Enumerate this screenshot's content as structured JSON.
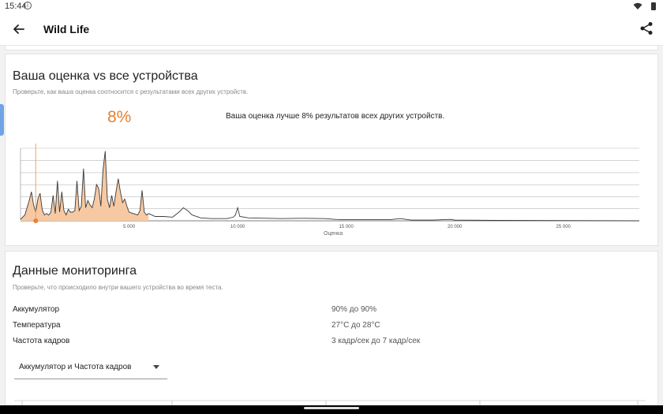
{
  "status_bar": {
    "time": "15:44",
    "info_icon": "info-icon",
    "wifi_icon": "wifi-icon",
    "battery_icon": "battery-icon"
  },
  "app_bar": {
    "title": "Wild Life",
    "back_icon": "arrow-left-icon",
    "share_icon": "share-icon"
  },
  "comparison": {
    "heading": "Ваша оценка vs все устройства",
    "subtitle": "Проверьте, как ваша оценка соотносится с результатами всех других устройств.",
    "percent": "8%",
    "statement": "Ваша оценка лучше 8% результатов всех других устройств.",
    "accent_color": "#e8802e"
  },
  "chart_data": {
    "type": "area",
    "xlabel": "Оценка",
    "ylabel": "",
    "x_ticks": [
      "5 000",
      "10 000",
      "15 000",
      "20 000",
      "25 000"
    ],
    "x_tick_values": [
      5000,
      10000,
      15000,
      20000,
      25000
    ],
    "xlim": [
      0,
      28500
    ],
    "ylim": [
      0,
      100
    ],
    "grid": true,
    "highlighted_range_max": 5900,
    "user_score_marker": 700,
    "series": [
      {
        "values": [
          [
            0,
            2
          ],
          [
            200,
            8
          ],
          [
            300,
            18
          ],
          [
            400,
            28
          ],
          [
            500,
            40
          ],
          [
            600,
            22
          ],
          [
            700,
            12
          ],
          [
            800,
            30
          ],
          [
            900,
            38
          ],
          [
            1000,
            15
          ],
          [
            1100,
            8
          ],
          [
            1200,
            10
          ],
          [
            1300,
            8
          ],
          [
            1400,
            12
          ],
          [
            1500,
            35
          ],
          [
            1600,
            10
          ],
          [
            1700,
            55
          ],
          [
            1800,
            12
          ],
          [
            1900,
            40
          ],
          [
            2000,
            14
          ],
          [
            2100,
            8
          ],
          [
            2200,
            16
          ],
          [
            2300,
            12
          ],
          [
            2400,
            12
          ],
          [
            2500,
            14
          ],
          [
            2600,
            55
          ],
          [
            2700,
            14
          ],
          [
            2800,
            20
          ],
          [
            2900,
            72
          ],
          [
            3000,
            18
          ],
          [
            3100,
            28
          ],
          [
            3200,
            22
          ],
          [
            3300,
            18
          ],
          [
            3400,
            30
          ],
          [
            3500,
            50
          ],
          [
            3600,
            45
          ],
          [
            3700,
            20
          ],
          [
            3800,
            70
          ],
          [
            3900,
            96
          ],
          [
            4000,
            30
          ],
          [
            4100,
            18
          ],
          [
            4200,
            35
          ],
          [
            4300,
            20
          ],
          [
            4400,
            40
          ],
          [
            4500,
            58
          ],
          [
            4600,
            40
          ],
          [
            4700,
            25
          ],
          [
            4800,
            30
          ],
          [
            4900,
            20
          ],
          [
            5000,
            12
          ],
          [
            5200,
            10
          ],
          [
            5400,
            8
          ],
          [
            5500,
            14
          ],
          [
            5600,
            42
          ],
          [
            5700,
            12
          ],
          [
            5800,
            8
          ],
          [
            5900,
            10
          ],
          [
            6200,
            6
          ],
          [
            6600,
            6
          ],
          [
            7000,
            5
          ],
          [
            7300,
            12
          ],
          [
            7500,
            18
          ],
          [
            7700,
            14
          ],
          [
            7900,
            8
          ],
          [
            8300,
            4
          ],
          [
            8800,
            3
          ],
          [
            9500,
            3
          ],
          [
            9800,
            5
          ],
          [
            9900,
            8
          ],
          [
            10000,
            18
          ],
          [
            10100,
            6
          ],
          [
            10500,
            4
          ],
          [
            12000,
            3
          ],
          [
            13000,
            3.5
          ],
          [
            14000,
            3
          ],
          [
            14500,
            2
          ],
          [
            15000,
            1.5
          ],
          [
            17000,
            1.5
          ],
          [
            17500,
            3
          ],
          [
            18000,
            1
          ],
          [
            19000,
            1
          ],
          [
            19800,
            2
          ],
          [
            20000,
            1
          ],
          [
            22000,
            0.5
          ],
          [
            25000,
            0.3
          ],
          [
            28500,
            0
          ]
        ]
      }
    ]
  },
  "monitoring": {
    "heading": "Данные мониторинга",
    "subtitle": "Проверьте, что происходило внутри вашего устройства во время теста.",
    "rows": [
      {
        "label": "Аккумулятор",
        "value": "90% до 90%"
      },
      {
        "label": "Температура",
        "value": "27°C до 28°C"
      },
      {
        "label": "Частота кадров",
        "value": "3 кадр/сек до 7 кадр/сек"
      }
    ],
    "dropdown_selected": "Аккумулятор и Частота кадров"
  }
}
